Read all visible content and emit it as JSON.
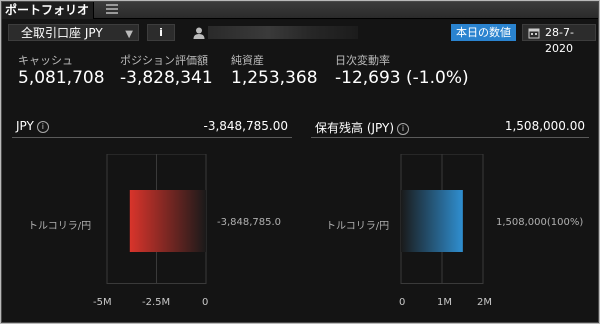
{
  "window": {
    "tab_title": "ポートフォリオ"
  },
  "toolbar": {
    "account": "全取引口座 JPY",
    "info_label": "i",
    "today_button": "本日の数値",
    "date": "28-7-2020"
  },
  "summary": [
    {
      "label": "キャッシュ",
      "value": "5,081,708"
    },
    {
      "label": "ポジション評価額",
      "value": "-3,828,341"
    },
    {
      "label": "純資産",
      "value": "1,253,368"
    },
    {
      "label": "日次変動率",
      "value": "-12,693 (-1.0%)"
    }
  ],
  "left_panel": {
    "title": "JPY",
    "total": "-3,848,785.00",
    "category": "トルコリラ/円",
    "bar_label": "-3,848,785.0",
    "ticks": [
      "-5M",
      "-2.5M",
      "0"
    ]
  },
  "right_panel": {
    "title": "保有残高 (JPY)",
    "total": "1,508,000.00",
    "category": "トルコリラ/円",
    "bar_label": "1,508,000(100%)",
    "ticks": [
      "0",
      "1M",
      "2M"
    ]
  },
  "chart_data": [
    {
      "type": "bar",
      "categories": [
        "トルコリラ/円"
      ],
      "values": [
        -3848785
      ],
      "xlim": [
        -5000000,
        0
      ],
      "xticks": [
        "-5M",
        "-2.5M",
        "0"
      ],
      "title": "JPY",
      "color": "#d9342b"
    },
    {
      "type": "bar",
      "categories": [
        "トルコリラ/円"
      ],
      "values": [
        1508000
      ],
      "xlim": [
        0,
        2000000
      ],
      "xticks": [
        "0",
        "1M",
        "2M"
      ],
      "title": "保有残高 (JPY)",
      "color": "#2f8fd1"
    }
  ]
}
